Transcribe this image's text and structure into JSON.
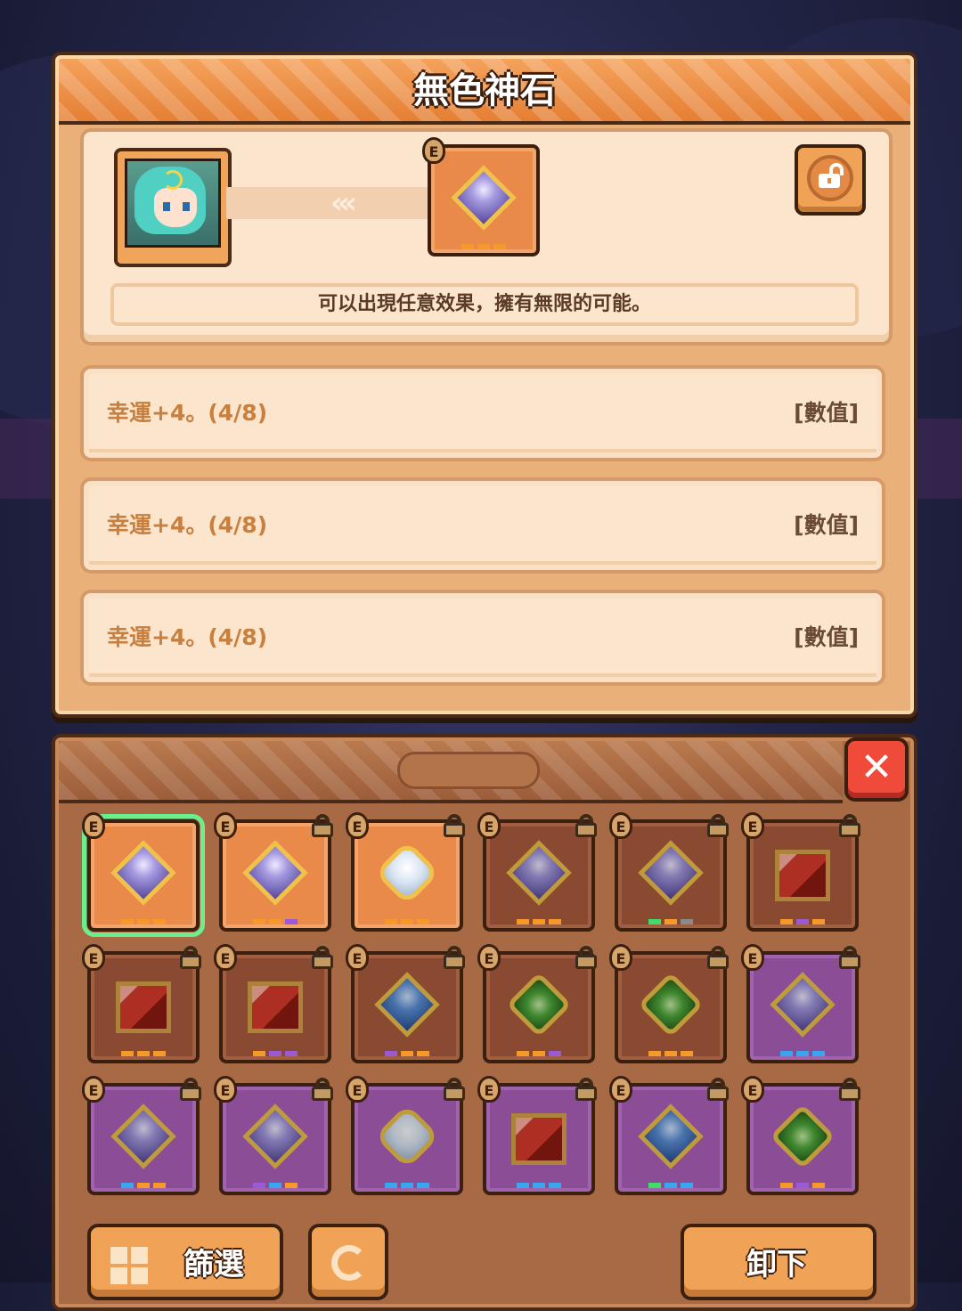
{
  "title": "無色神石",
  "detail": {
    "arrows": "‹‹‹",
    "description": "可以出現任意效果，擁有無限的可能。",
    "item_badge": "E",
    "item_pips": [
      "#f59a2a",
      "#f59a2a",
      "#f59a2a"
    ]
  },
  "effects": [
    {
      "text": "幸運+4。(4/8)",
      "tag": "[數值]"
    },
    {
      "text": "幸運+4。(4/8)",
      "tag": "[數值]"
    },
    {
      "text": "幸運+4。(4/8)",
      "tag": "[數值]"
    }
  ],
  "inventory": {
    "close_label": "✕",
    "items": [
      {
        "bg": "orange",
        "gem": "violet",
        "badge": "E",
        "locked": false,
        "selected": true,
        "pips": [
          "#f59a2a",
          "#f59a2a",
          "#f59a2a"
        ]
      },
      {
        "bg": "orange",
        "gem": "violet",
        "badge": "E",
        "locked": true,
        "selected": false,
        "pips": [
          "#f59a2a",
          "#f59a2a",
          "#9b59d6"
        ]
      },
      {
        "bg": "orange",
        "gem": "white",
        "badge": "E",
        "locked": true,
        "selected": false,
        "pips": [
          "#f59a2a",
          "#f59a2a",
          "#f59a2a"
        ]
      },
      {
        "bg": "brown",
        "gem": "violet",
        "badge": "E",
        "locked": true,
        "selected": false,
        "pips": [
          "#f59a2a",
          "#f59a2a",
          "#f59a2a"
        ]
      },
      {
        "bg": "brown",
        "gem": "violet",
        "badge": "E",
        "locked": true,
        "selected": false,
        "pips": [
          "#3fdc6a",
          "#f59a2a",
          "#8a8a8a"
        ]
      },
      {
        "bg": "brown",
        "gem": "red",
        "badge": "E",
        "locked": true,
        "selected": false,
        "pips": [
          "#f59a2a",
          "#9b59d6",
          "#f59a2a"
        ]
      },
      {
        "bg": "brown",
        "gem": "red",
        "badge": "E",
        "locked": true,
        "selected": false,
        "pips": [
          "#f59a2a",
          "#f59a2a",
          "#f59a2a"
        ]
      },
      {
        "bg": "brown",
        "gem": "red",
        "badge": "E",
        "locked": true,
        "selected": false,
        "pips": [
          "#f59a2a",
          "#9b59d6",
          "#9b59d6"
        ]
      },
      {
        "bg": "brown",
        "gem": "blue",
        "badge": "E",
        "locked": true,
        "selected": false,
        "pips": [
          "#9b59d6",
          "#f59a2a",
          "#f59a2a"
        ]
      },
      {
        "bg": "brown",
        "gem": "green",
        "badge": "E",
        "locked": true,
        "selected": false,
        "pips": [
          "#f59a2a",
          "#f59a2a",
          "#9b59d6"
        ]
      },
      {
        "bg": "brown",
        "gem": "green",
        "badge": "E",
        "locked": true,
        "selected": false,
        "pips": [
          "#f59a2a",
          "#f59a2a",
          "#f59a2a"
        ]
      },
      {
        "bg": "purple",
        "gem": "violet",
        "badge": "E",
        "locked": true,
        "selected": false,
        "pips": [
          "#39a7f0",
          "#39a7f0",
          "#39a7f0"
        ]
      },
      {
        "bg": "purple",
        "gem": "violet",
        "badge": "E",
        "locked": true,
        "selected": false,
        "pips": [
          "#39a7f0",
          "#f59a2a",
          "#f59a2a"
        ]
      },
      {
        "bg": "purple",
        "gem": "violet",
        "badge": "E",
        "locked": true,
        "selected": false,
        "pips": [
          "#9b59d6",
          "#39a7f0",
          "#f59a2a"
        ]
      },
      {
        "bg": "purple",
        "gem": "white",
        "badge": "E",
        "locked": true,
        "selected": false,
        "pips": [
          "#39a7f0",
          "#39a7f0",
          "#39a7f0"
        ]
      },
      {
        "bg": "purple",
        "gem": "red",
        "badge": "E",
        "locked": true,
        "selected": false,
        "pips": [
          "#39a7f0",
          "#39a7f0",
          "#39a7f0"
        ]
      },
      {
        "bg": "purple",
        "gem": "blue",
        "badge": "E",
        "locked": true,
        "selected": false,
        "pips": [
          "#3fdc6a",
          "#39a7f0",
          "#39a7f0"
        ]
      },
      {
        "bg": "purple",
        "gem": "green",
        "badge": "E",
        "locked": true,
        "selected": false,
        "pips": [
          "#f59a2a",
          "#9b59d6",
          "#f59a2a"
        ]
      }
    ]
  },
  "buttons": {
    "filter_label": "篩選",
    "unequip_label": "卸下"
  },
  "icons": {
    "lock_toggle": "open-lock-icon",
    "filter": "grid-icon",
    "refresh": "refresh-icon",
    "close": "close-icon"
  }
}
